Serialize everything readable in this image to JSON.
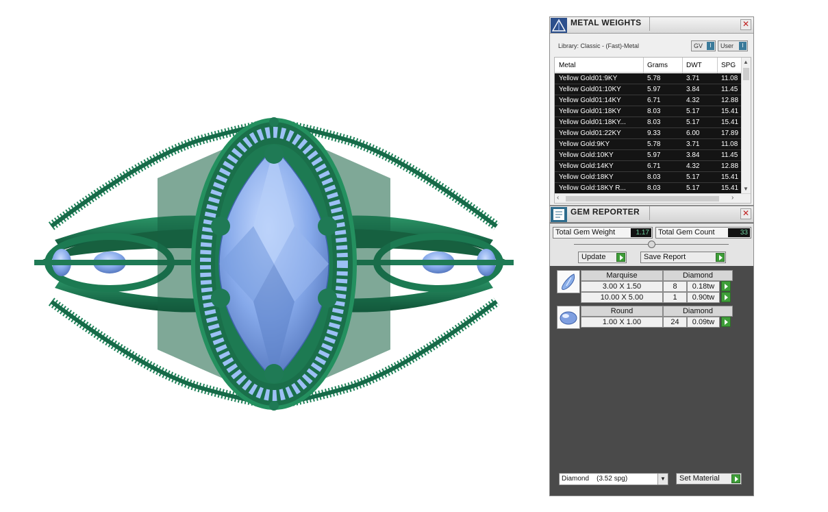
{
  "metal_weights": {
    "title": "METAL WEIGHTS",
    "library_label": "Library: Classic - (Fast)-Metal",
    "toggle_gv": "GV",
    "toggle_user": "User",
    "toggle_knob": "I",
    "columns": [
      "Metal",
      "Grams",
      "DWT",
      "SPG"
    ],
    "rows": [
      [
        "Yellow Gold01:9KY",
        "5.78",
        "3.71",
        "11.08"
      ],
      [
        "Yellow Gold01:10KY",
        "5.97",
        "3.84",
        "11.45"
      ],
      [
        "Yellow Gold01:14KY",
        "6.71",
        "4.32",
        "12.88"
      ],
      [
        "Yellow Gold01:18KY",
        "8.03",
        "5.17",
        "15.41"
      ],
      [
        "Yellow Gold01:18KY...",
        "8.03",
        "5.17",
        "15.41"
      ],
      [
        "Yellow Gold01:22KY",
        "9.33",
        "6.00",
        "17.89"
      ],
      [
        "Yellow Gold:9KY",
        "5.78",
        "3.71",
        "11.08"
      ],
      [
        "Yellow Gold:10KY",
        "5.97",
        "3.84",
        "11.45"
      ],
      [
        "Yellow Gold:14KY",
        "6.71",
        "4.32",
        "12.88"
      ],
      [
        "Yellow Gold:18KY",
        "8.03",
        "5.17",
        "15.41"
      ],
      [
        "Yellow Gold:18KY R...",
        "8.03",
        "5.17",
        "15.41"
      ]
    ]
  },
  "gem_reporter": {
    "title": "GEM REPORTER",
    "total_weight_label": "Total Gem Weight",
    "total_weight_value": "1.17",
    "total_count_label": "Total Gem Count",
    "total_count_value": "33",
    "update_label": "Update",
    "save_report_label": "Save Report",
    "groups": [
      {
        "cut": "Marquise",
        "material": "Diamond",
        "items": [
          {
            "size": "3.00 X 1.50",
            "count": "8",
            "weight": "0.18tw"
          },
          {
            "size": "10.00 X 5.00",
            "count": "1",
            "weight": "0.90tw"
          }
        ]
      },
      {
        "cut": "Round",
        "material": "Diamond",
        "items": [
          {
            "size": "1.00 X 1.00",
            "count": "24",
            "weight": "0.09tw"
          }
        ]
      }
    ],
    "material_select": "Diamond    (3.52 spg)",
    "set_material_label": "Set Material"
  },
  "colors": {
    "metal_green": "#1f7a55",
    "gem_blue": "#8fb4ee",
    "panel_dark": "#4a4a4a"
  }
}
